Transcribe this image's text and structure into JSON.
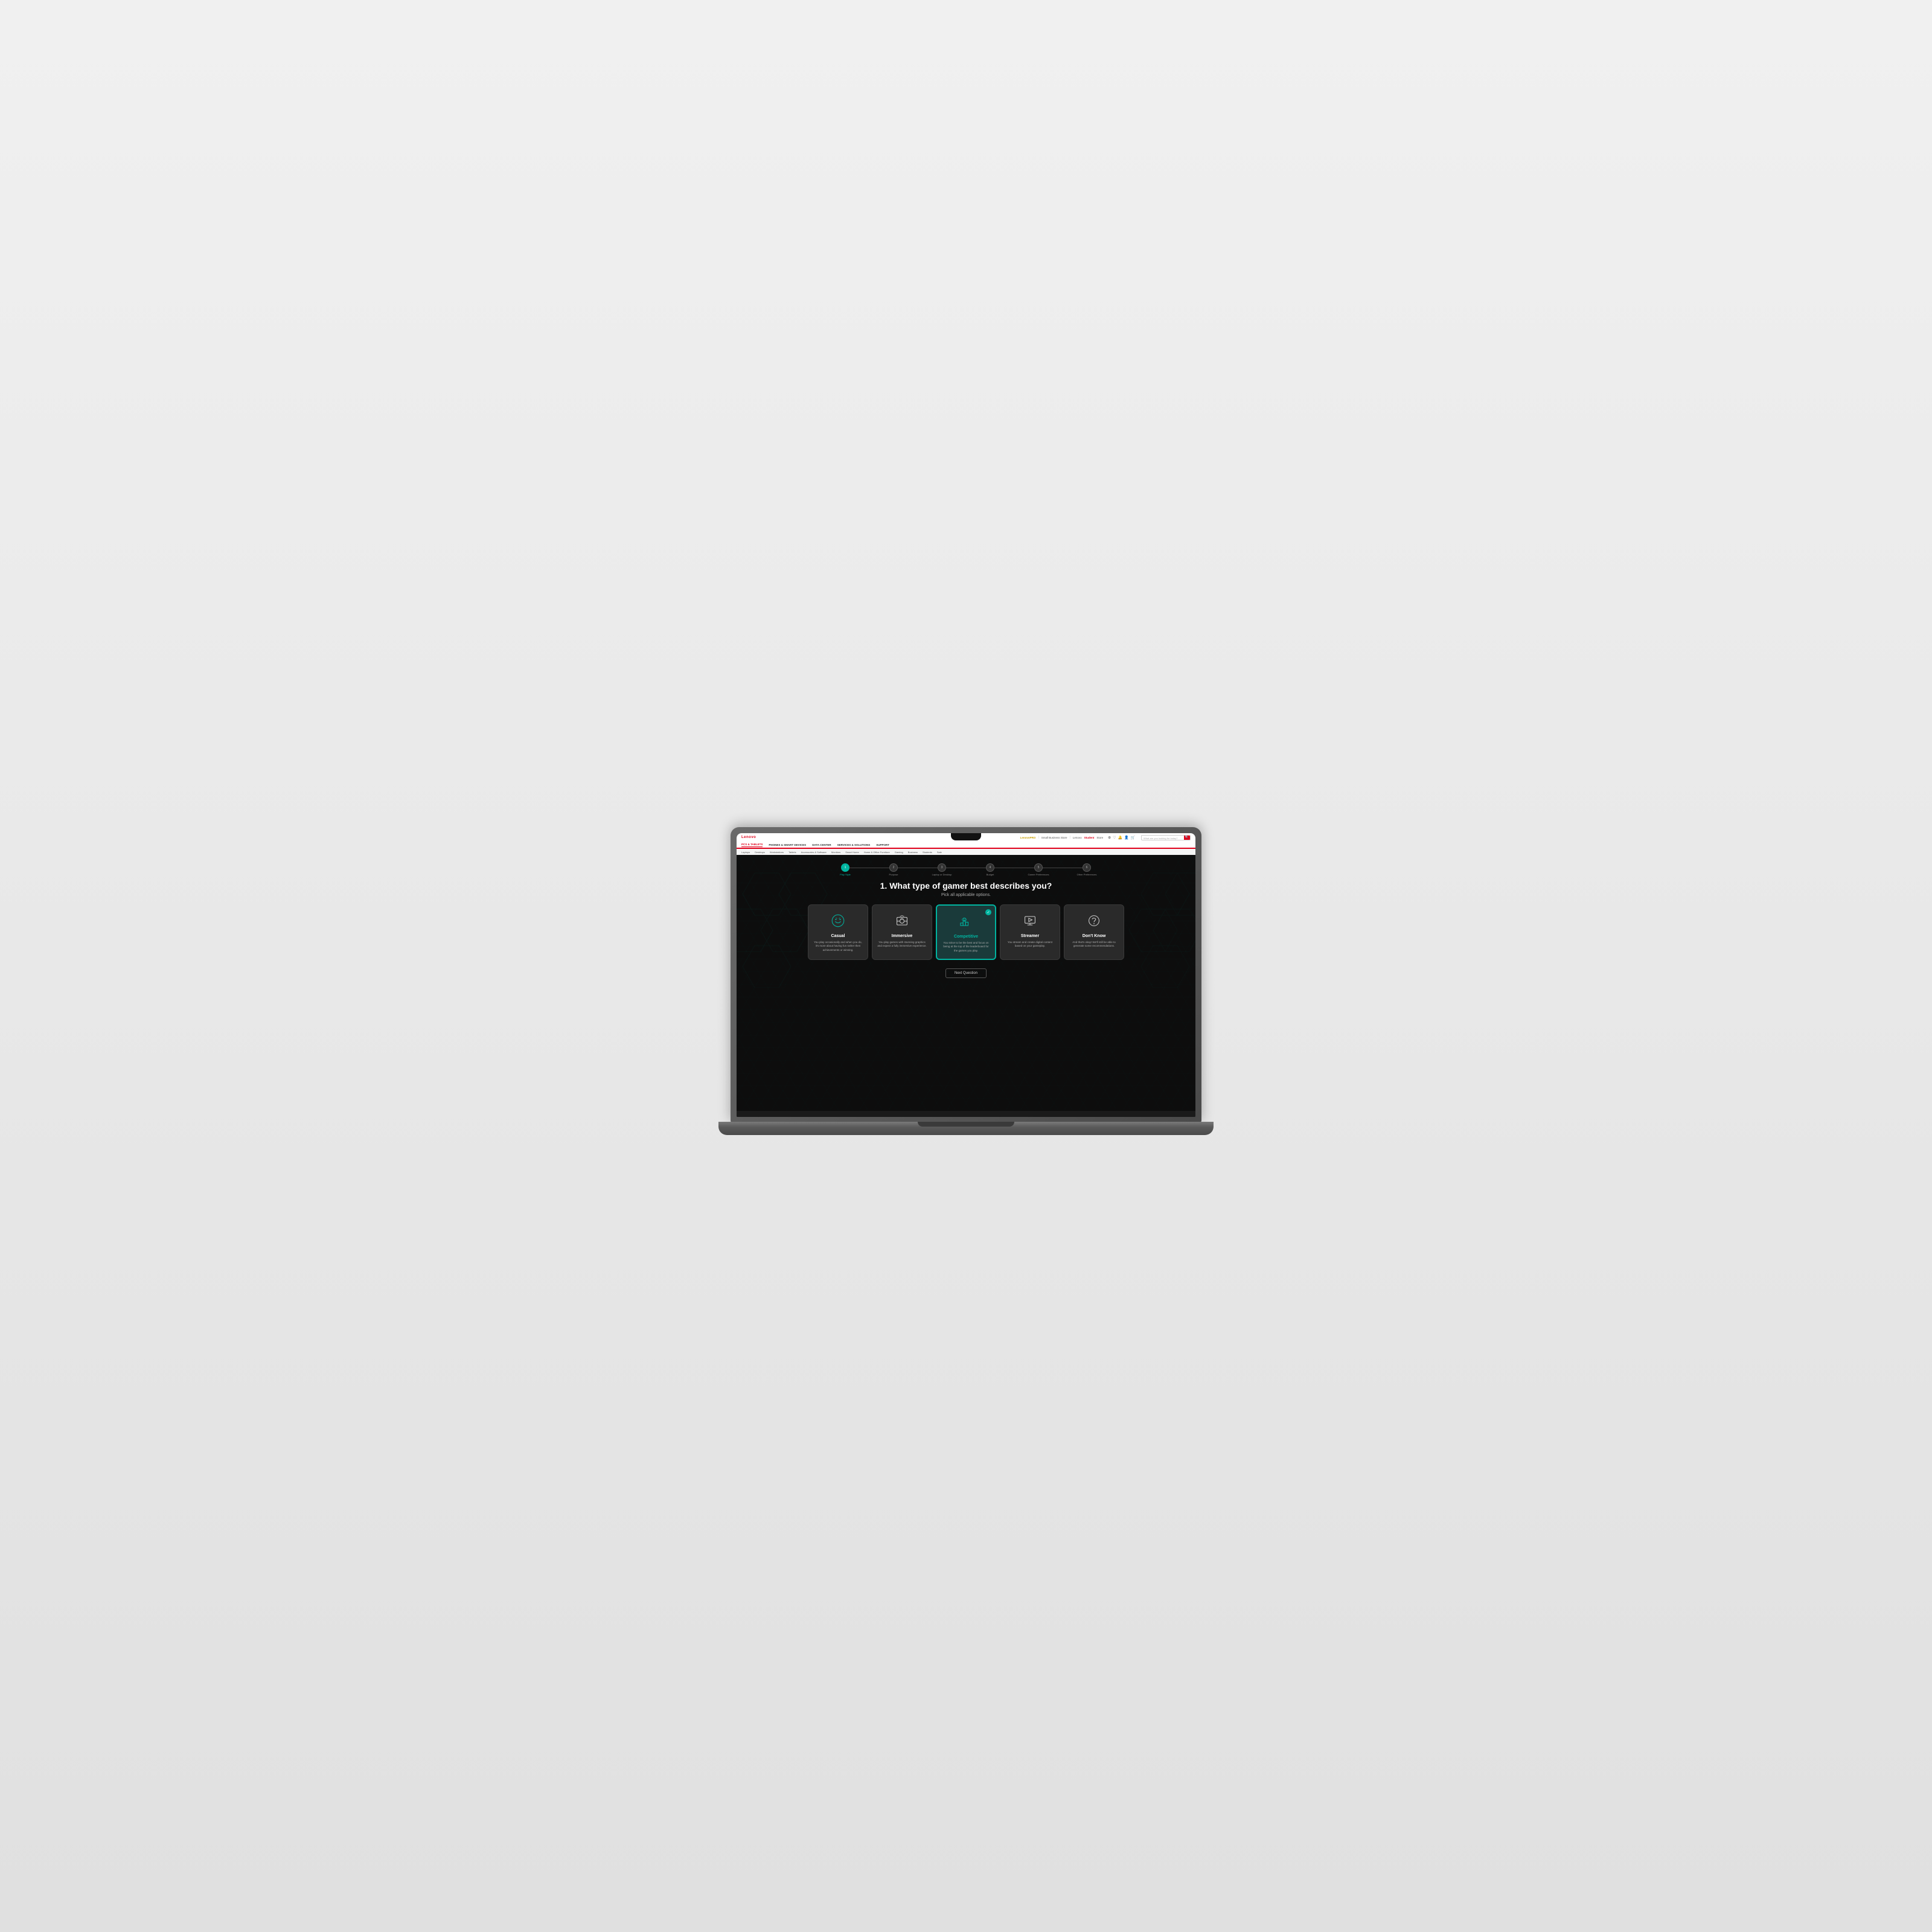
{
  "laptop": {
    "visible": true
  },
  "website": {
    "topbar": {
      "logo": "Lenovo",
      "pro_label": "Lenovo PRO",
      "pro_sub": "Small Business Store",
      "student_label": "Lenovo Student Store",
      "search_placeholder": "What are you looking for today?",
      "icons": [
        "search",
        "heart",
        "bell",
        "user",
        "x",
        "cart"
      ]
    },
    "nav_primary": [
      {
        "label": "PCS & TABLETS",
        "active": false
      },
      {
        "label": "PHONES & SMART DEVICES",
        "active": false
      },
      {
        "label": "DATA CENTER",
        "active": false
      },
      {
        "label": "SERVICES & SOLUTIONS",
        "active": false
      },
      {
        "label": "SUPPORT",
        "active": false
      }
    ],
    "nav_secondary": [
      "Laptops",
      "Desktops",
      "Workstations",
      "Tablets",
      "Accessories & Software",
      "Monitors",
      "Smart Home",
      "Home & Office Furniture",
      "Gaming",
      "Business",
      "Students",
      "Sale"
    ],
    "progress": {
      "steps": [
        {
          "number": "1",
          "label": "Play Style",
          "active": true
        },
        {
          "number": "2",
          "label": "Purpose",
          "active": false
        },
        {
          "number": "3",
          "label": "Laptop or Desktop",
          "active": false
        },
        {
          "number": "4",
          "label": "Budget",
          "active": false
        },
        {
          "number": "5",
          "label": "Gamer Preferences",
          "active": false
        },
        {
          "number": "6",
          "label": "Other Preferences",
          "active": false
        }
      ]
    },
    "question": {
      "title": "1. What type of gamer best describes you?",
      "subtitle": "Pick all applicable options.",
      "cards": [
        {
          "id": "casual",
          "title": "Casual",
          "description": "You play occasionally and when you do, it's more about having fun rather then achievements or winning.",
          "selected": false,
          "icon": "casual"
        },
        {
          "id": "immersive",
          "title": "Immersive",
          "description": "You play games with stunning graphics and expect a fully immersive experience.",
          "selected": false,
          "icon": "immersive"
        },
        {
          "id": "competitive",
          "title": "Competitive",
          "description": "You strive to be the best and focus on being at the top of the leaderboard for the games you play.",
          "selected": true,
          "icon": "competitive"
        },
        {
          "id": "streamer",
          "title": "Streamer",
          "description": "You stream and create digital content based on your gameplay.",
          "selected": false,
          "icon": "streamer"
        },
        {
          "id": "dontknow",
          "title": "Don't Know",
          "description": "And that's okay! We'll still be able to generate some recommendations.",
          "selected": false,
          "icon": "dontknow"
        }
      ],
      "next_button": "Next Question"
    }
  }
}
